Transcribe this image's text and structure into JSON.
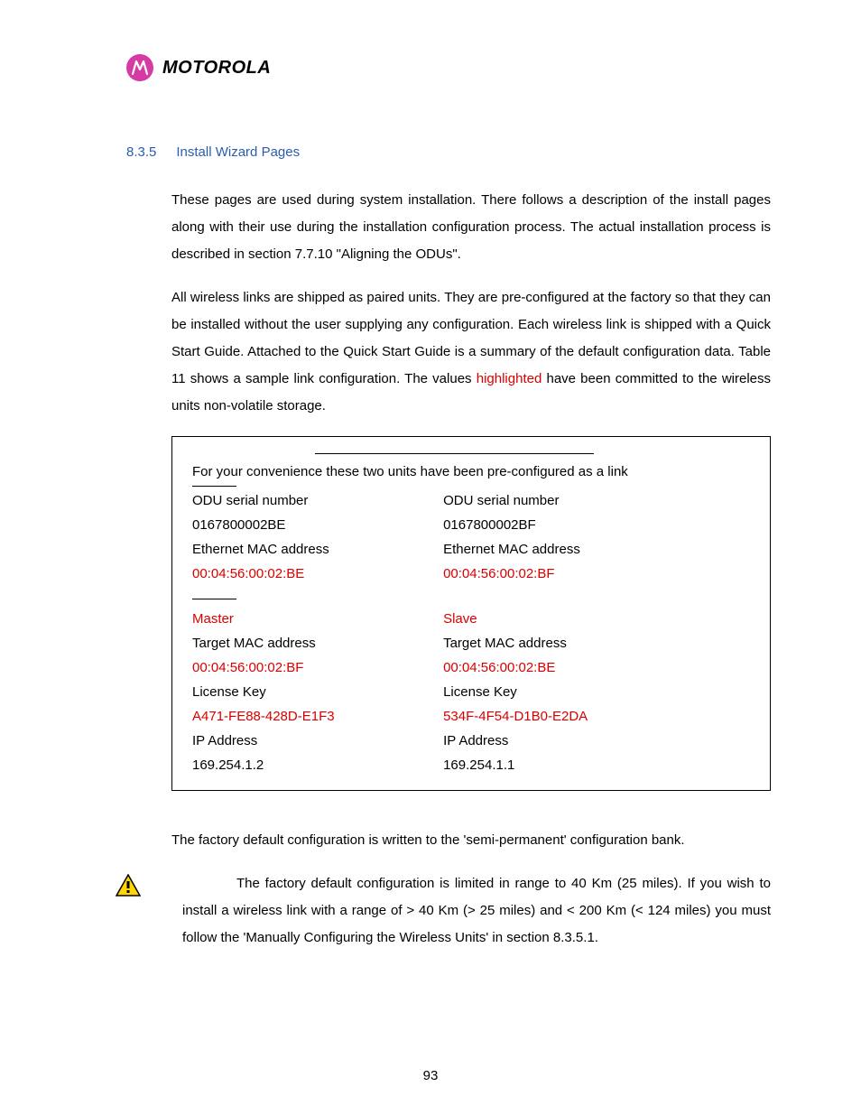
{
  "logo": {
    "glyph": "M",
    "text": "MOTOROLA"
  },
  "heading": {
    "number": "8.3.5",
    "title": "Install Wizard Pages"
  },
  "para1_part1": "These pages are used during system installation. There follows a description of the install pages along with their use during the installation configuration process. The actual installation process is described in section 7.7.10 \"Aligning the ODUs\".",
  "para2_part1": "All wireless links are shipped as paired units. They are pre-configured at the factory so that they can be installed without the user supplying any configuration. Each wireless link is shipped with a Quick Start Guide. Attached to the Quick Start Guide is a summary of the default configuration data. Table 11 shows a sample link configuration. The values ",
  "para2_hl": "highlighted",
  "para2_part2": " have been committed to the wireless units non-volatile storage.",
  "box": {
    "title": "For your convenience these two units have been pre-configured as a link",
    "left": {
      "odu_label": "ODU serial number",
      "odu_val": "0167800002BE",
      "mac_label": "Ethernet MAC address",
      "mac_val": "00:04:56:00:02:BE",
      "role": "Master",
      "target_label": "Target MAC address",
      "target_val": "00:04:56:00:02:BF",
      "lic_label": "License Key",
      "lic_val": "A471-FE88-428D-E1F3",
      "ip_label": "IP Address",
      "ip_val": "169.254.1.2"
    },
    "right": {
      "odu_label": "ODU serial number",
      "odu_val": "0167800002BF",
      "mac_label": "Ethernet MAC address",
      "mac_val": "00:04:56:00:02:BF",
      "role": "Slave",
      "target_label": "Target MAC address",
      "target_val": "00:04:56:00:02:BE",
      "lic_label": "License Key",
      "lic_val": "534F-4F54-D1B0-E2DA",
      "ip_label": "IP Address",
      "ip_val": "169.254.1.1"
    }
  },
  "para3": "The factory default configuration is written to the 'semi-permanent' configuration bank.",
  "warning": "The factory default configuration is limited in range to 40 Km (25 miles). If you wish to install a wireless link with a range of > 40 Km (> 25 miles) and < 200 Km (< 124 miles) you must follow the 'Manually Configuring the Wireless Units' in section 8.3.5.1.",
  "page_number": "93"
}
